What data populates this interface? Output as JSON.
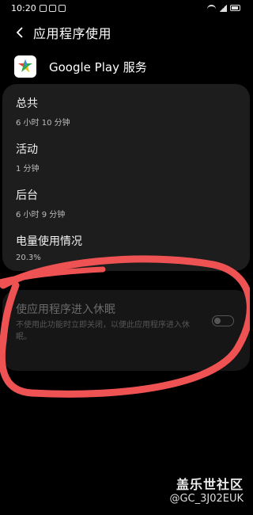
{
  "status_bar": {
    "time": "10:20"
  },
  "app_bar": {
    "title": "应用程序使用"
  },
  "app": {
    "name": "Google Play 服务",
    "icon": "google-play-services-icon"
  },
  "usage": {
    "total": {
      "label": "总共",
      "value": "6 小时 10 分钟"
    },
    "active": {
      "label": "活动",
      "value": "1 分钟"
    },
    "background": {
      "label": "后台",
      "value": "6 小时 9 分钟"
    },
    "battery": {
      "label": "电量使用情况",
      "value": "20.3%"
    }
  },
  "sleep": {
    "title": "使应用程序进入休眠",
    "description": "不使用此功能时立即关闭，以便此应用程序进入休眠。",
    "enabled": false
  },
  "watermark": {
    "brand": "盖乐世社区",
    "user": "@GC_3J02EUK"
  },
  "colors": {
    "background": "#000000",
    "card": "#1d1d1d",
    "scribble": "#ee5253"
  }
}
